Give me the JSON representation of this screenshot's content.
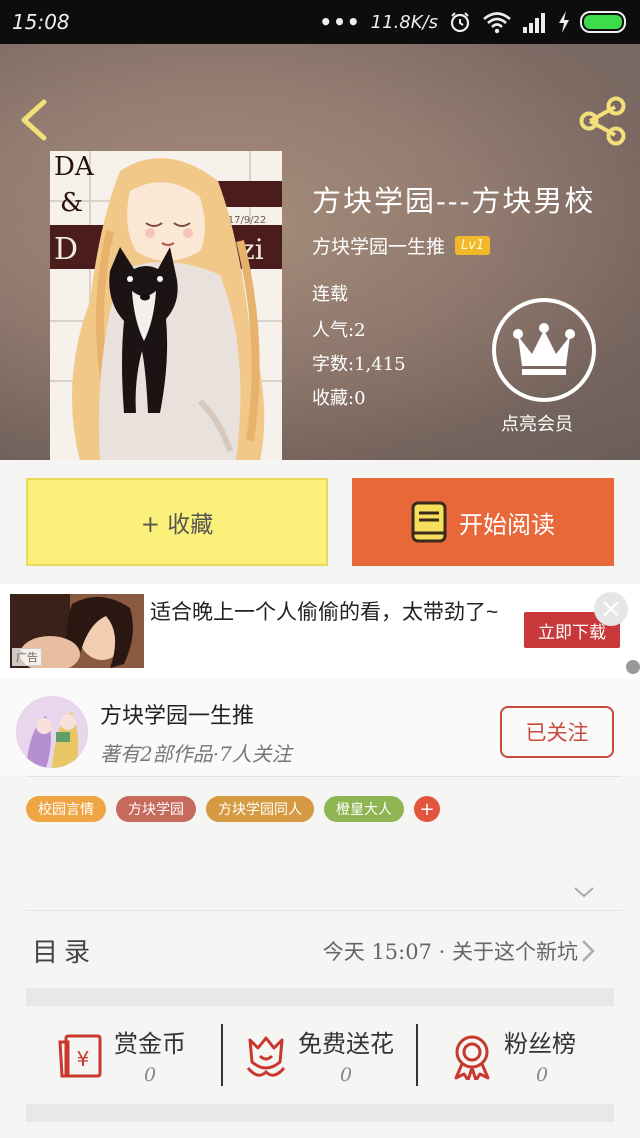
{
  "status_bar": {
    "time": "15:08",
    "network_speed": "11.8K/s",
    "icons": [
      "more-dots-icon",
      "alarm-icon",
      "wifi-icon",
      "signal-icon",
      "charging-icon",
      "battery-icon"
    ]
  },
  "header": {
    "back_icon": "chevron-left-icon",
    "share_icon": "share-icon",
    "cover_text": {
      "line1": "DA",
      "line2": "&",
      "line3": "D",
      "line3b": "zi",
      "date": "2017/9/22"
    },
    "book_title": "方块学园---方块男校",
    "author": "方块学园一生推",
    "level": "Lv1",
    "status": "连载",
    "popularity": "人气:2",
    "word_count": "字数:1,415",
    "favorites": "收藏:0",
    "vip_icon": "crown-icon",
    "vip_label": "点亮会员"
  },
  "actions": {
    "collect_label": "+ 收藏",
    "read_label": "开始阅读",
    "read_icon": "book-icon"
  },
  "ad": {
    "tag": "广告",
    "text": "适合晚上一个人偷偷的看，太带劲了~",
    "button": "立即下载",
    "close_icon": "close-icon"
  },
  "author_section": {
    "name": "方块学园一生推",
    "stats": "著有2部作品·7人关注",
    "follow_label": "已关注"
  },
  "tags": [
    {
      "label": "校园言情",
      "color": "#f0a545"
    },
    {
      "label": "方块学园",
      "color": "#c66a5b"
    },
    {
      "label": "方块学园同人",
      "color": "#d59a42"
    },
    {
      "label": "橙皇大人",
      "color": "#8fb552"
    }
  ],
  "tag_add": "+",
  "catalog": {
    "title": "目录",
    "latest": "今天 15:07 · 关于这个新坑"
  },
  "rewards": [
    {
      "label": "赏金币",
      "count": "0",
      "icon": "red-envelope-icon"
    },
    {
      "label": "免费送花",
      "count": "0",
      "icon": "flower-icon"
    },
    {
      "label": "粉丝榜",
      "count": "0",
      "icon": "medal-icon"
    }
  ],
  "colors": {
    "accent_orange": "#e8683a",
    "collect_yellow": "#fbf07a",
    "follow_red": "#c84a3e",
    "icon_red": "#c8382c"
  }
}
